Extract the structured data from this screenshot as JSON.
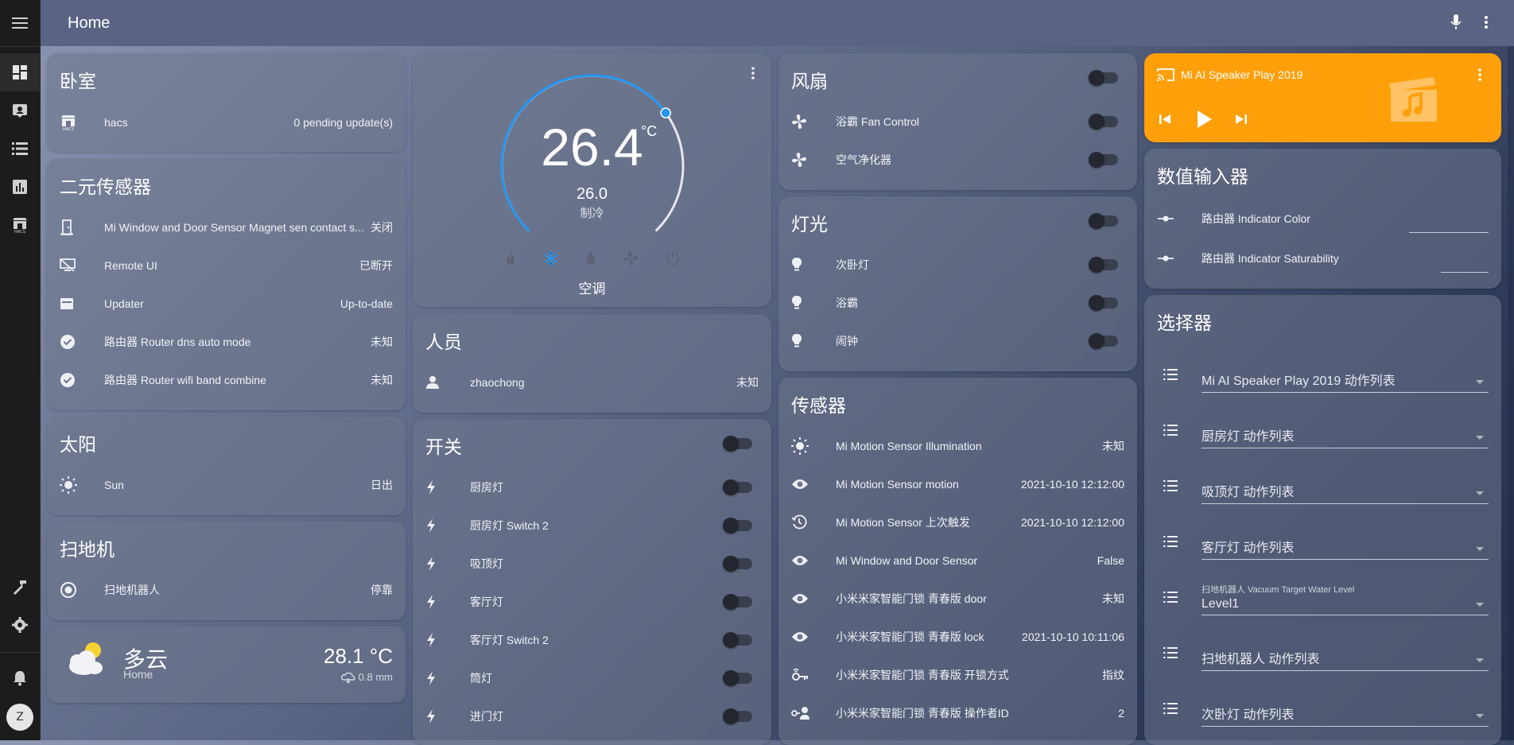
{
  "header": {
    "title": "Home"
  },
  "sidebar": {
    "avatar_letter": "Z"
  },
  "bedroom": {
    "title": "卧室",
    "rows": [
      {
        "name": "hacs",
        "value": "0 pending update(s)"
      }
    ]
  },
  "binary_sensors": {
    "title": "二元传感器",
    "rows": [
      {
        "name": "Mi Window and Door Sensor Magnet sen contact s...",
        "value": "关闭"
      },
      {
        "name": "Remote UI",
        "value": "已断开"
      },
      {
        "name": "Updater",
        "value": "Up-to-date"
      },
      {
        "name": "路由器 Router dns auto mode",
        "value": "未知"
      },
      {
        "name": "路由器 Router wifi band combine",
        "value": "未知"
      }
    ]
  },
  "sun": {
    "title": "太阳",
    "rows": [
      {
        "name": "Sun",
        "value": "日出"
      }
    ]
  },
  "vacuum": {
    "title": "扫地机",
    "rows": [
      {
        "name": "扫地机器人",
        "value": "停靠"
      }
    ]
  },
  "weather": {
    "condition": "多云",
    "location": "Home",
    "temperature": "28.1 °C",
    "precipitation": "0.8 mm"
  },
  "thermostat": {
    "current": "26.4",
    "unit": "°C",
    "target": "26.0",
    "mode_label": "制冷",
    "name": "空调",
    "arc_fraction": 0.7
  },
  "people": {
    "title": "人员",
    "rows": [
      {
        "name": "zhaochong",
        "value": "未知"
      }
    ]
  },
  "switches": {
    "title": "开关",
    "rows": [
      {
        "name": "厨房灯"
      },
      {
        "name": "厨房灯 Switch 2"
      },
      {
        "name": "吸顶灯"
      },
      {
        "name": "客厅灯"
      },
      {
        "name": "客厅灯 Switch 2"
      },
      {
        "name": "筒灯"
      },
      {
        "name": "进门灯"
      }
    ]
  },
  "fans": {
    "title": "风扇",
    "rows": [
      {
        "name": "浴霸 Fan Control"
      },
      {
        "name": "空气净化器"
      }
    ]
  },
  "lights": {
    "title": "灯光",
    "rows": [
      {
        "name": "次卧灯"
      },
      {
        "name": "浴霸"
      },
      {
        "name": "闹钟"
      }
    ]
  },
  "sensors": {
    "title": "传感器",
    "rows": [
      {
        "name": "Mi Motion Sensor Illumination",
        "value": "未知"
      },
      {
        "name": "Mi Motion Sensor motion",
        "value": "2021-10-10 12:12:00"
      },
      {
        "name": "Mi Motion Sensor 上次触发",
        "value": "2021-10-10 12:12:00"
      },
      {
        "name": "Mi Window and Door Sensor",
        "value": "False"
      },
      {
        "name": "小米米家智能门锁 青春版 door",
        "value": "未知"
      },
      {
        "name": "小米米家智能门锁 青春版 lock",
        "value": "2021-10-10 10:11:06"
      },
      {
        "name": "小米米家智能门锁 青春版 开锁方式",
        "value": "指纹"
      },
      {
        "name": "小米米家智能门锁 青春版 操作者ID",
        "value": "2"
      }
    ]
  },
  "media": {
    "title": "Mi AI Speaker Play 2019",
    "accent": "#ff9f0a"
  },
  "number_inputs": {
    "title": "数值输入器",
    "rows": [
      {
        "name": "路由器 Indicator Color"
      },
      {
        "name": "路由器 Indicator Saturability"
      }
    ]
  },
  "selectors": {
    "title": "选择器",
    "rows": [
      {
        "label": "",
        "value": "Mi AI Speaker Play 2019 动作列表"
      },
      {
        "label": "",
        "value": "厨房灯 动作列表"
      },
      {
        "label": "",
        "value": "吸顶灯 动作列表"
      },
      {
        "label": "",
        "value": "客厅灯 动作列表"
      },
      {
        "label": "扫地机器人 Vacuum Target Water Level",
        "value": "Level1"
      },
      {
        "label": "",
        "value": "扫地机器人 动作列表"
      },
      {
        "label": "",
        "value": "次卧灯 动作列表"
      }
    ]
  },
  "colors": {
    "accent_blue": "#2196f3",
    "media_orange": "#ff9f0a"
  }
}
